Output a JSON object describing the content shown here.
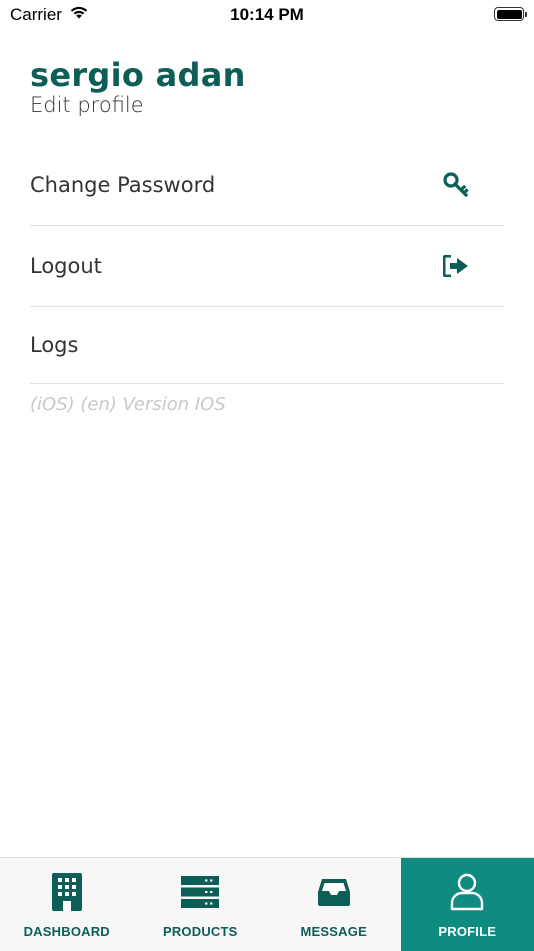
{
  "status_bar": {
    "carrier": "Carrier",
    "time": "10:14 PM"
  },
  "profile": {
    "name": "sergio adan",
    "edit_label": "Edit profile"
  },
  "menu": {
    "items": [
      {
        "label": "Change Password",
        "icon": "key-icon"
      },
      {
        "label": "Logout",
        "icon": "logout-icon"
      },
      {
        "label": "Logs",
        "icon": ""
      }
    ],
    "version": "(iOS) (en) Version IOS"
  },
  "tabs": [
    {
      "label": "DASHBOARD",
      "icon": "building-icon",
      "active": false
    },
    {
      "label": "PRODUCTS",
      "icon": "server-icon",
      "active": false
    },
    {
      "label": "MESSAGE",
      "icon": "inbox-icon",
      "active": false
    },
    {
      "label": "PROFILE",
      "icon": "user-icon",
      "active": true
    }
  ],
  "colors": {
    "accent": "#0d5e57",
    "active_tab": "#0f8c7f"
  }
}
